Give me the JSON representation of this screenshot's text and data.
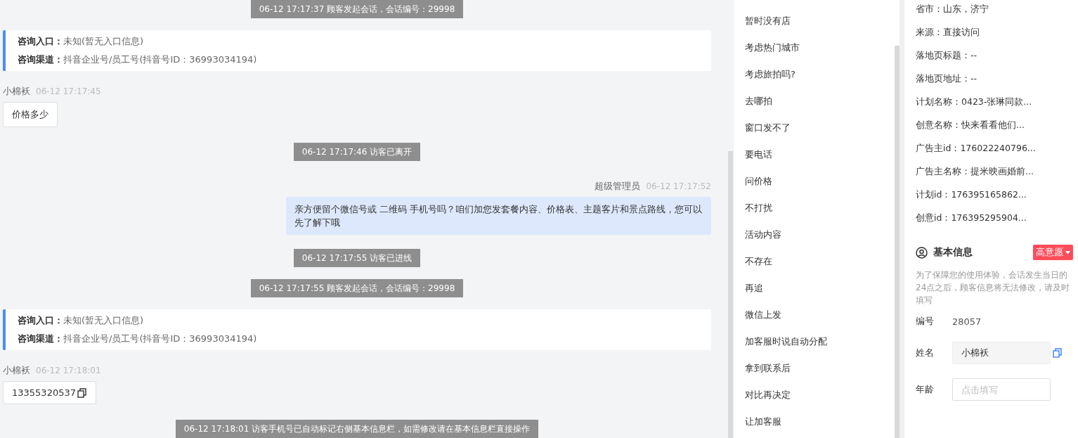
{
  "chat": {
    "messages": [
      {
        "kind": "system",
        "text": "06-12 17:17:37 顾客发起会话，会话编号：29998"
      },
      {
        "kind": "entry",
        "rows": [
          {
            "label": "咨询入口：",
            "value": "未知(暂无入口信息)"
          },
          {
            "label": "咨询渠道：",
            "value": "抖音企业号/员工号(抖音号ID：36993034194)"
          }
        ]
      },
      {
        "kind": "customer",
        "sender": "小棉袄",
        "time": "06-12 17:17:45",
        "text": "价格多少",
        "copy": false
      },
      {
        "kind": "system",
        "text": "06-12 17:17:46 访客已离开"
      },
      {
        "kind": "agent",
        "sender": "超级管理员",
        "time": "06-12 17:17:52",
        "text": "亲方便留个微信号或 二维码 手机号吗？咱们加您发套餐内容、价格表、主题客片和景点路线，您可以先了解下哦"
      },
      {
        "kind": "system",
        "text": "06-12 17:17:55 访客已进线"
      },
      {
        "kind": "system",
        "text": "06-12 17:17:55 顾客发起会话，会话编号：29998"
      },
      {
        "kind": "entry",
        "rows": [
          {
            "label": "咨询入口：",
            "value": "未知(暂无入口信息)"
          },
          {
            "label": "咨询渠道：",
            "value": "抖音企业号/员工号(抖音号ID：36993034194)"
          }
        ]
      },
      {
        "kind": "customer",
        "sender": "小棉袄",
        "time": "06-12 17:18:01",
        "text": "13355320537",
        "copy": true
      },
      {
        "kind": "system",
        "text": "06-12 17:18:01 访客手机号已自动标记右侧基本信息栏，如需修改请在基本信息栏直接操作"
      }
    ]
  },
  "quick_replies": [
    "暂时没有店",
    "考虑热门城市",
    "考虑旅拍吗?",
    "去哪拍",
    "窗口发不了",
    "要电话",
    "问价格",
    "不打扰",
    "活动内容",
    "不存在",
    "再追",
    "微信上发",
    "加客服时说自动分配",
    "拿到联系后",
    "对比再决定",
    "让加客服"
  ],
  "visitor_info": [
    "省市：山东，济宁",
    "来源：直接访问",
    "落地页标题：--",
    "落地页地址：--",
    "计划名称：0423-张琳同款...",
    "创意名称：快来看看他们...",
    "广告主id：176022240796...",
    "广告主名称：提米映画婚前...",
    "计划id：176395165862...",
    "创意id：176395295904..."
  ],
  "basic_info": {
    "title": "基本信息",
    "intent_tag": "高意愿",
    "note": "为了保障您的使用体验，会话发生当日的24点之后，顾客信息将无法修改，请及时填写",
    "fields": [
      {
        "kind": "text",
        "label": "编号",
        "value": "28057"
      },
      {
        "kind": "filled",
        "label": "姓名",
        "value": "小棉袄"
      },
      {
        "kind": "input",
        "label": "年龄",
        "placeholder": "点击填写"
      }
    ]
  }
}
